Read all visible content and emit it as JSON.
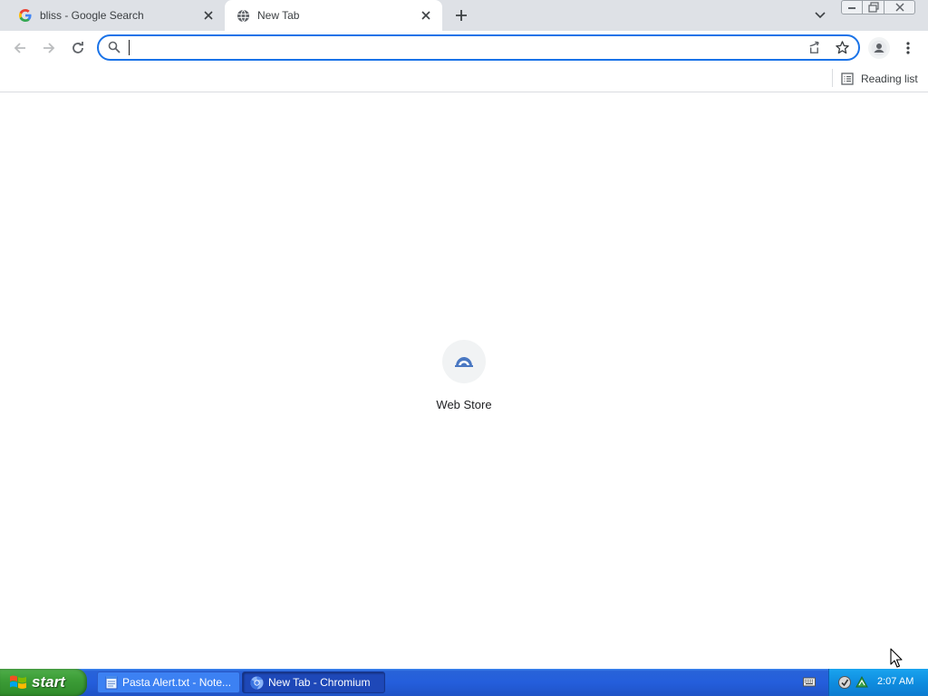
{
  "browser": {
    "tabs": [
      {
        "title": "bliss - Google Search",
        "active": false,
        "favicon": "google-g-icon"
      },
      {
        "title": "New Tab",
        "active": true,
        "favicon": "globe-icon"
      }
    ],
    "omnibox": {
      "value": "",
      "placeholder": ""
    },
    "bookmarks_bar": {
      "reading_list_label": "Reading list"
    },
    "accent_color": "#1a73e8"
  },
  "new_tab_page": {
    "shortcuts": [
      {
        "label": "Web Store",
        "icon": "web-store-icon"
      }
    ]
  },
  "taskbar": {
    "start_label": "start",
    "items": [
      {
        "label": "Pasta Alert.txt - Note...",
        "icon": "notepad-icon",
        "active": false
      },
      {
        "label": "New Tab - Chromium",
        "icon": "chromium-icon",
        "active": true
      }
    ],
    "clock": "2:07 AM",
    "colors": {
      "bar": "#245edc",
      "start": "#3c9d37",
      "tray": "#0f8de0"
    }
  }
}
